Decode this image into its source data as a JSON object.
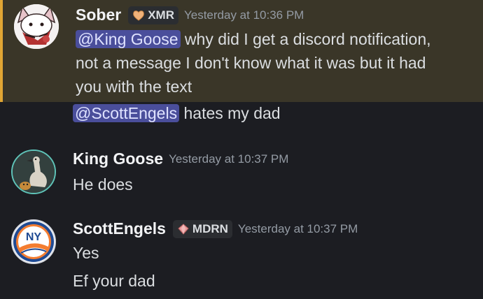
{
  "messages": [
    {
      "username": "Sober",
      "tag": "XMR",
      "timestamp": "Yesterday at 10:36 PM",
      "mention": "@King Goose",
      "lines": [
        " why did I get a discord notification,",
        "not a message I don't know what it was but it had",
        "you with the text"
      ]
    },
    {
      "mention": "@ScottEngels",
      "text": " hates my dad"
    },
    {
      "username": "King Goose",
      "timestamp": "Yesterday at 10:37 PM",
      "lines": [
        "He does"
      ]
    },
    {
      "username": "ScottEngels",
      "tag": "MDRN",
      "timestamp": "Yesterday at 10:37 PM",
      "lines": [
        "Yes",
        "Ef your dad"
      ]
    }
  ],
  "avatars": {
    "sober": "cat-avatar",
    "king_goose": "goose-avatar",
    "scott_engels": "islanders-logo-avatar",
    "islanders_logo_text": "NY ISLANDERS"
  },
  "colors": {
    "background": "#1c1d22",
    "highlight_bg": "#3a3628",
    "highlight_border": "#e0a534",
    "mention_bg": "#4a4e9b",
    "mention_text": "#dfe2ff",
    "timestamp": "#949ba4"
  }
}
